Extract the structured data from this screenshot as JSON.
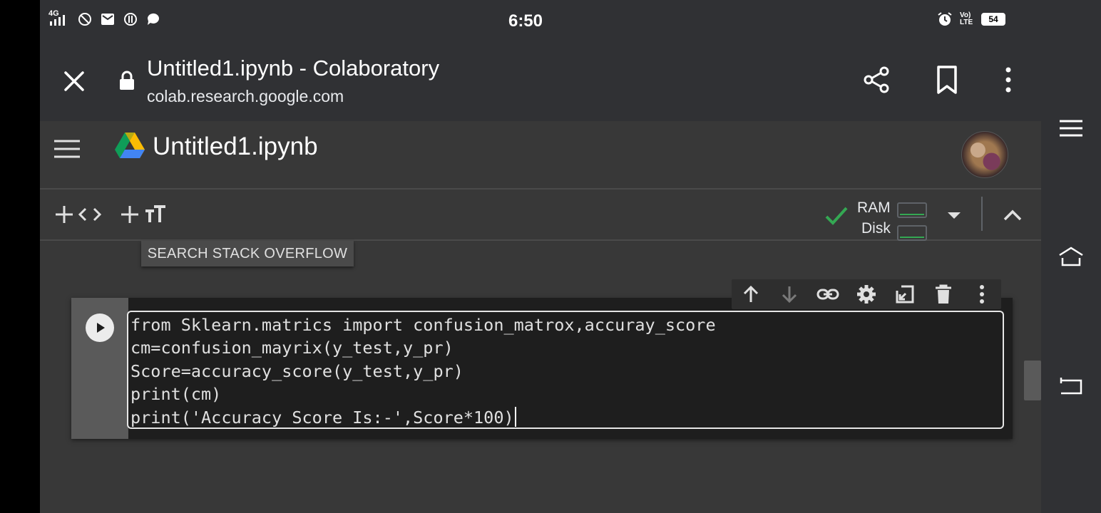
{
  "status_bar": {
    "time": "6:50",
    "network": "4G",
    "volte": "Vo) LTE",
    "battery": "54",
    "left_icons": [
      "signal-icon",
      "shield-icon",
      "mail-icon",
      "data-saver-icon",
      "chat-icon"
    ],
    "right_icons": [
      "alarm-icon",
      "volte-icon",
      "battery-icon"
    ]
  },
  "browser": {
    "page_title": "Untitled1.ipynb - Colaboratory",
    "url": "colab.research.google.com",
    "actions": [
      "share-icon",
      "bookmark-icon",
      "more-vert-icon"
    ]
  },
  "colab": {
    "notebook_title": "Untitled1.ipynb",
    "toolbar": {
      "add_code_icons": "+ <>",
      "add_text_icons": "+ TT",
      "ram_label": "RAM",
      "disk_label": "Disk"
    },
    "search_stack_overflow": "SEARCH STACK OVERFLOW",
    "cell": {
      "code_lines": [
        "from Sklearn.matrics import confusion_matrox,accuray_score",
        "cm=confusion_mayrix(y_test,y_pr)",
        "Score=accuracy_score(y_test,y_pr)",
        "print(cm)",
        "print('Accuracy Score Is:-',Score*100)"
      ]
    },
    "cell_toolbar": [
      "move-up-icon",
      "move-down-icon",
      "link-icon",
      "settings-icon",
      "mirror-cell-icon",
      "delete-icon",
      "more-vert-icon"
    ]
  },
  "colors": {
    "background": "#383838",
    "bar": "#303134",
    "code_bg": "#1e1e1e",
    "check_green": "#34a853"
  }
}
